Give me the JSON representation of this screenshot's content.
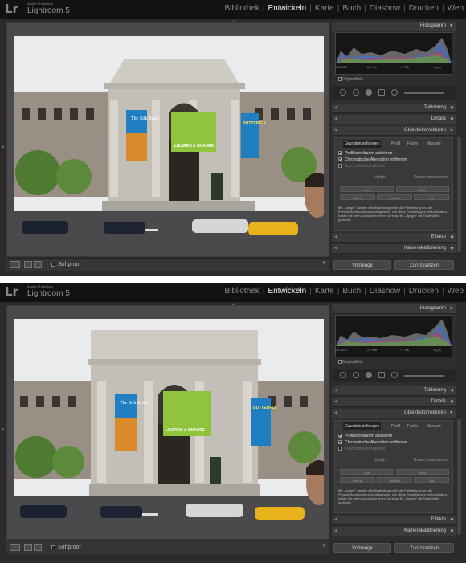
{
  "app": {
    "brand_small": "Adobe Photoshop",
    "brand_name": "Lightroom 5",
    "logo": "Lr"
  },
  "modules": [
    {
      "label": "Bibliothek",
      "active": false
    },
    {
      "label": "Entwickeln",
      "active": true
    },
    {
      "label": "Karte",
      "active": false
    },
    {
      "label": "Buch",
      "active": false
    },
    {
      "label": "Diashow",
      "active": false
    },
    {
      "label": "Drucken",
      "active": false
    },
    {
      "label": "Web",
      "active": false
    }
  ],
  "panels": {
    "histogram": "Histogramm",
    "tonung": "Teiltonung",
    "details": "Details",
    "objektiv": "Objektivkorrekturen",
    "effekte": "Effekte",
    "kamera": "Kamerakalibrierung"
  },
  "lens": {
    "tabs": [
      "Grundeinstellungen",
      "Profil",
      "Farbe",
      "Manuell"
    ],
    "profile": "Profilkorrekturen aktivieren",
    "chroma": "Chromatische Aberration entfernen",
    "constrain": "Zuschnitt beschränken",
    "upright": "Upright",
    "upright_all": "Erneut analysieren",
    "btn_off": "Aus",
    "btn_auto": "Auto",
    "btn_level": "Ebene",
    "btn_vertical": "Vertikal",
    "btn_full": "Voll",
    "note": "Mit „Upright\" werden alle Einstellungen für die Freistellung und die Perspektivenkorrektur zurückgesetzt. Um diese Einstellungen beizubehalten, halten Sie beim Auswählen einer Korrektur für „Upright\" die Taste Wahl gedrückt."
  },
  "histogram_info": {
    "iso": "ISO 200",
    "focal": "24 mm",
    "aperture": "f / 5,6",
    "shutter": "¹⁄₂₅₀ s",
    "original": "Originalfoto"
  },
  "toolbar": {
    "softproof": "Softproof"
  },
  "buttons": {
    "previous": "Vorherige",
    "reset": "Zurücksetzen"
  },
  "photo": {
    "banner_left": "The Silk Road",
    "banner_center": "LIZARDS & SNAKES",
    "banner_right": "BUTTERFLY",
    "colors": {
      "sky": "#e8eaec",
      "stone": "#c6c1b8",
      "taxi": "#e8b21a",
      "banner_green": "#8fc43c",
      "banner_blue": "#1f7fc2"
    }
  }
}
